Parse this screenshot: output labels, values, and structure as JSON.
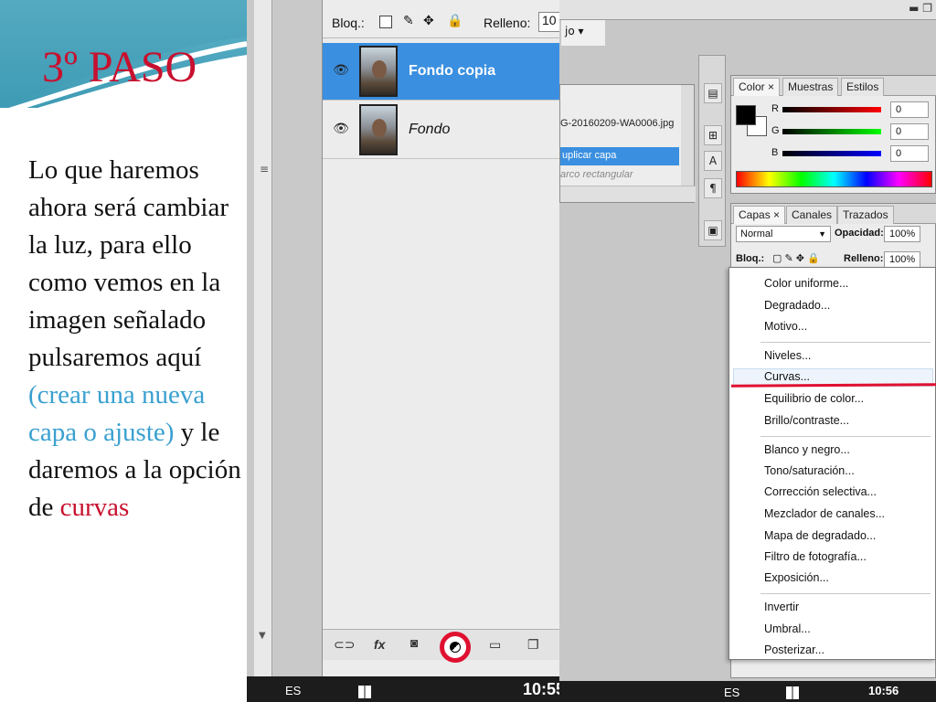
{
  "slide": {
    "title": "3º PASO",
    "body_part1": "Lo que haremos ahora será cambiar la luz, para ello como vemos en la imagen señalado pulsaremos aquí",
    "body_highlight": "(crear una nueva capa o ajuste)",
    "body_part2": "y le daremos a la opción de",
    "body_red": "curvas",
    "colors": {
      "title": "#c8102e",
      "highlight": "#3aa0d0",
      "accent_red": "#c8102e",
      "header_teal": "#4aa8c0"
    }
  },
  "ps_left": {
    "lock_label": "Bloq.:",
    "fill_label": "Relleno:",
    "fill_value": "10",
    "layers": [
      {
        "name": "Fondo copia",
        "selected": true,
        "icon": "eye-icon"
      },
      {
        "name": "Fondo",
        "selected": false,
        "icon": "eye-icon"
      }
    ],
    "bottom_icons": [
      "link-icon",
      "fx-icon",
      "mask-icon",
      "adjustment-layer-icon",
      "folder-icon",
      "new-layer-icon"
    ],
    "fx_label": "fx"
  },
  "ps_right": {
    "top_menu": "jo",
    "history": {
      "filename": "G-20160209-WA0006.jpg",
      "selected_item": "uplicar capa",
      "item2": "arco rectangular"
    },
    "color_panel": {
      "tabs": [
        "Color",
        "Muestras",
        "Estilos"
      ],
      "channels": [
        {
          "label": "R",
          "value": "0",
          "color": "#e00000"
        },
        {
          "label": "G",
          "value": "0",
          "color": "#00b000"
        },
        {
          "label": "B",
          "value": "0",
          "color": "#0000d0"
        }
      ]
    },
    "layers_panel": {
      "tabs": [
        "Capas",
        "Canales",
        "Trazados"
      ],
      "blend_mode": "Normal",
      "opacity_label": "Opacidad:",
      "opacity_value": "100%",
      "lock_label": "Bloq.:",
      "fill_label": "Relleno:",
      "fill_value": "100%"
    },
    "context_menu": {
      "items": [
        "Color uniforme...",
        "Degradado...",
        "Motivo...",
        "Niveles...",
        "Curvas...",
        "Equilibrio de color...",
        "Brillo/contraste...",
        "Blanco y negro...",
        "Tono/saturación...",
        "Corrección selectiva...",
        "Mezclador de canales...",
        "Mapa de degradado...",
        "Filtro de fotografía...",
        "Exposición...",
        "Invertir",
        "Umbral...",
        "Posterizar..."
      ],
      "highlighted": "Curvas..."
    }
  },
  "taskbar_left": {
    "lang": "ES",
    "clock": "10:55"
  },
  "taskbar_right": {
    "lang": "ES",
    "clock": "10:56"
  }
}
